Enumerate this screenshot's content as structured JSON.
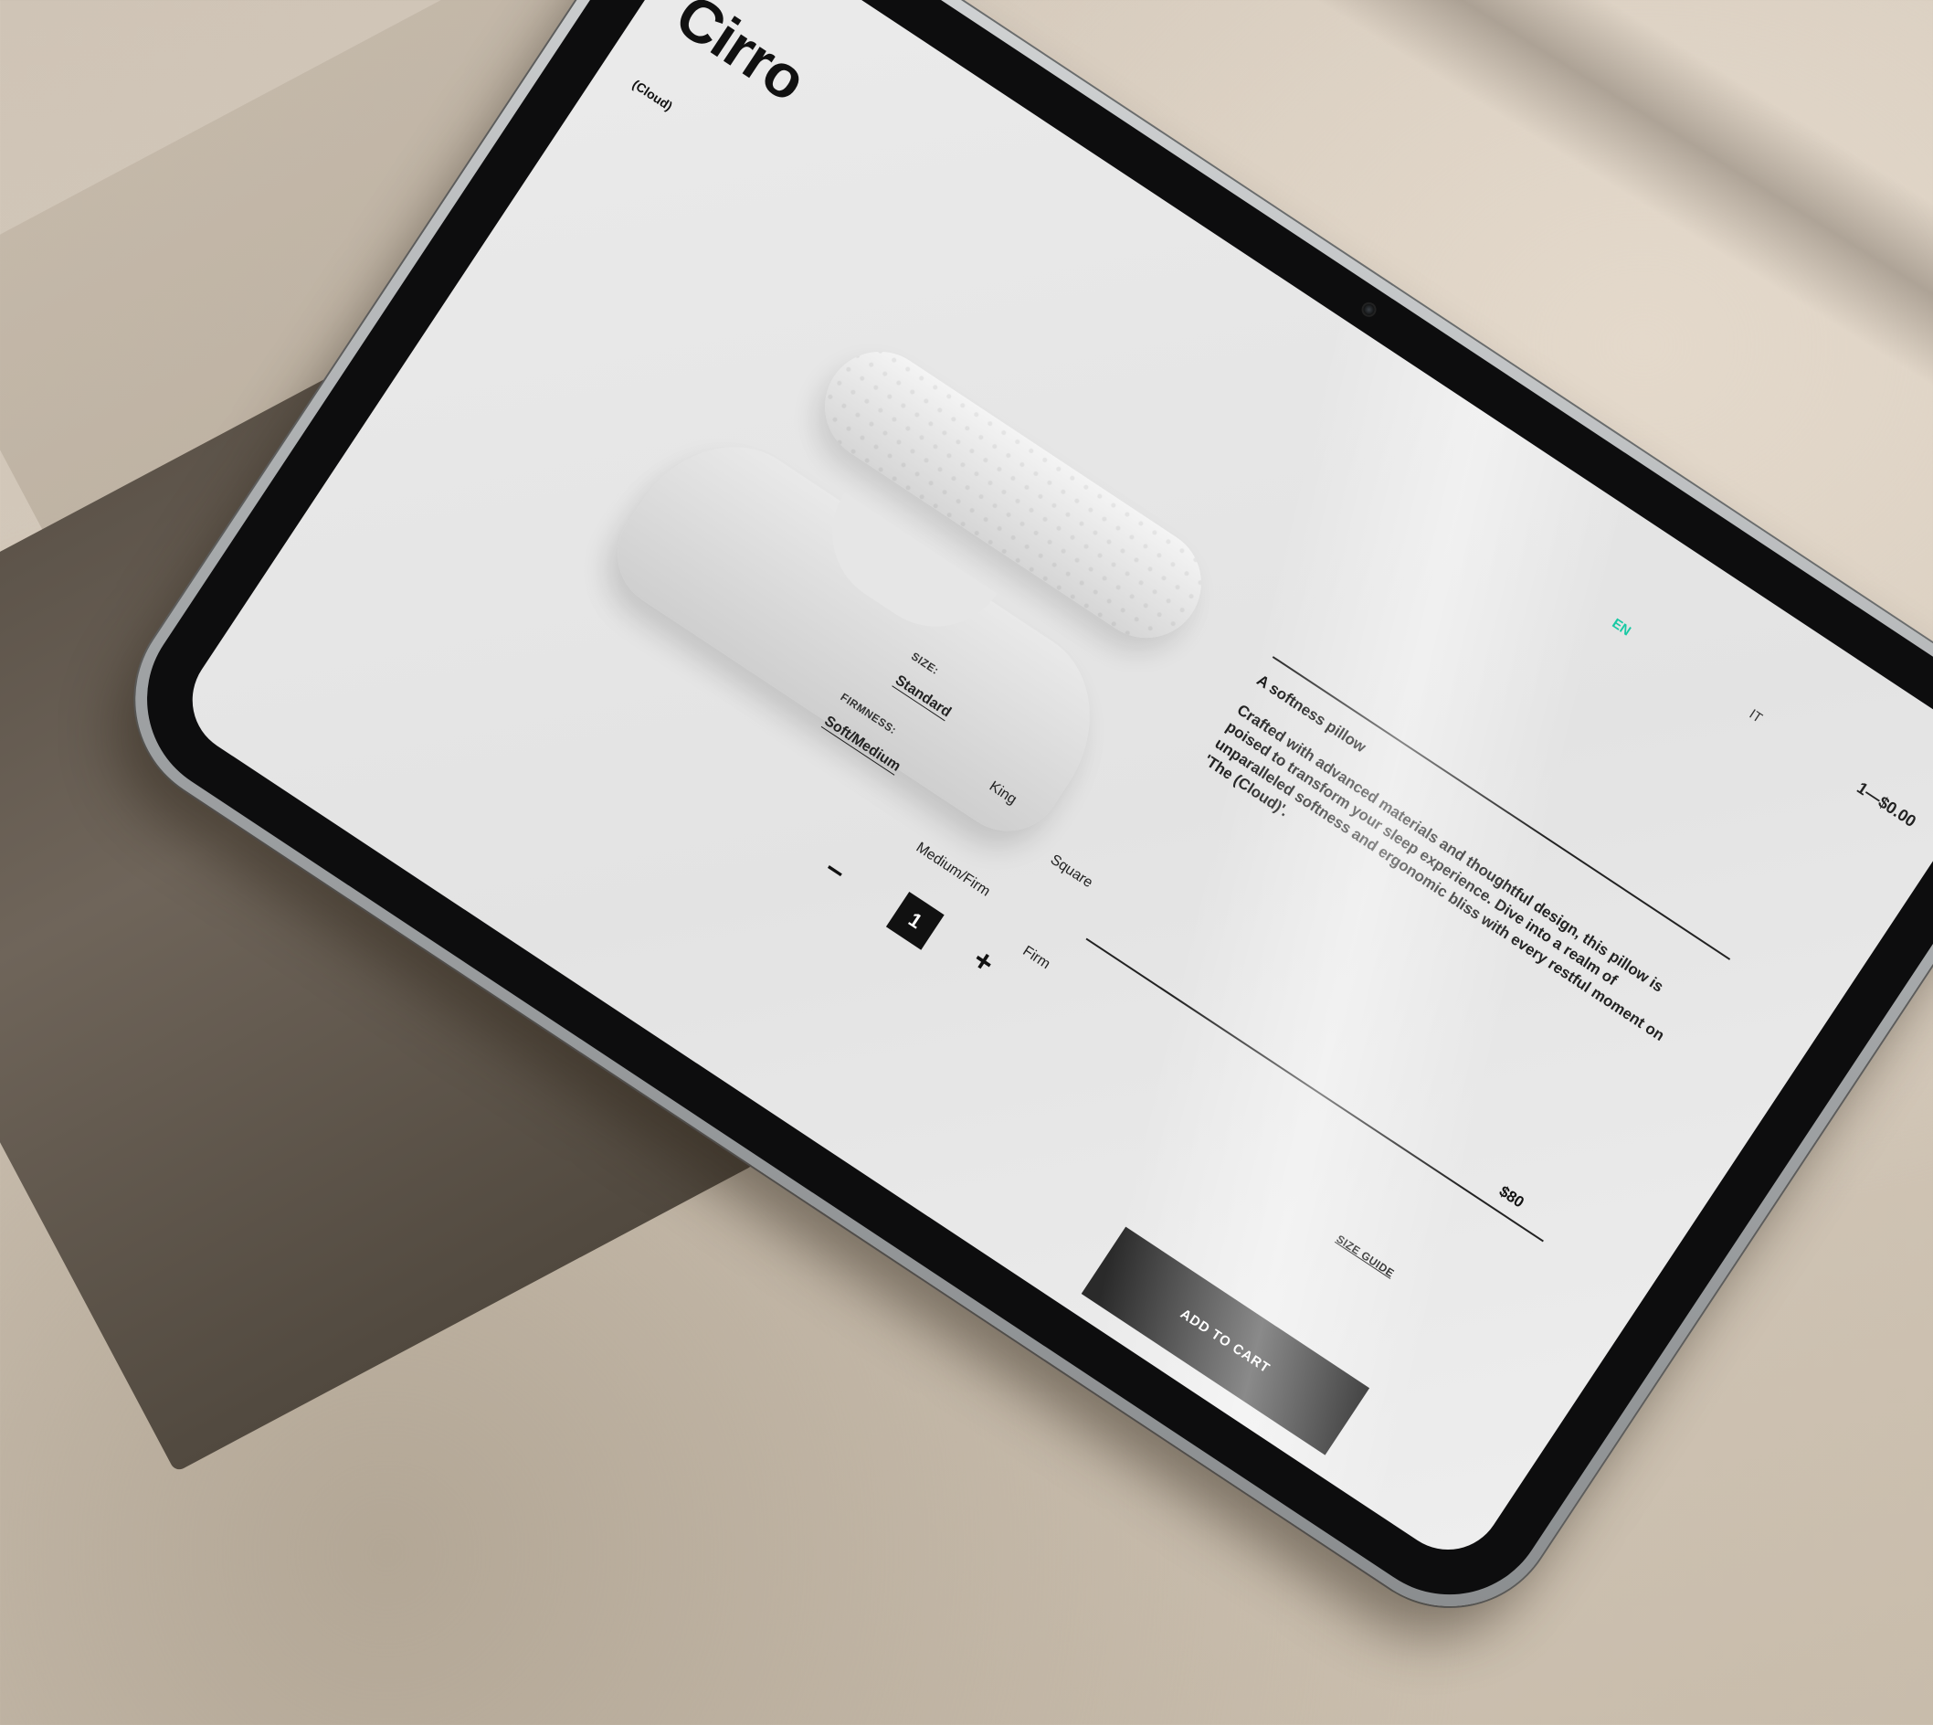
{
  "header": {
    "menu_icon": "hamburger-menu-icon",
    "brand": "Cirro",
    "brand_sub": "(Cloud)",
    "languages": [
      "EN",
      "IT"
    ],
    "active_language": "EN",
    "cart_summary": "1—$0.00"
  },
  "product": {
    "title": "A softness pillow",
    "description": "Crafted with advanced materials and thoughtful design, this pillow is poised to transform your sleep experience. Dive into a realm of unparalleled softness and ergonomic bliss with every restful moment on 'The (Cloud)'.",
    "price": "$80"
  },
  "options": {
    "size": {
      "label": "SIZE:",
      "values": [
        "Standard",
        "King",
        "Square"
      ],
      "selected": "Standard"
    },
    "firmness": {
      "label": "FIRMNESS:",
      "values": [
        "Soft/Medium",
        "Medium/Firm",
        "Firm"
      ],
      "selected": "Soft/Medium"
    }
  },
  "quantity": {
    "minus": "–",
    "value": "1",
    "plus": "+"
  },
  "size_guide": "SIZE GUIDE",
  "add_to_cart": "ADD TO CART",
  "colors": {
    "accent": "#19c9a4",
    "button": "#2a2a2a",
    "screen": "#e8e8e8"
  }
}
